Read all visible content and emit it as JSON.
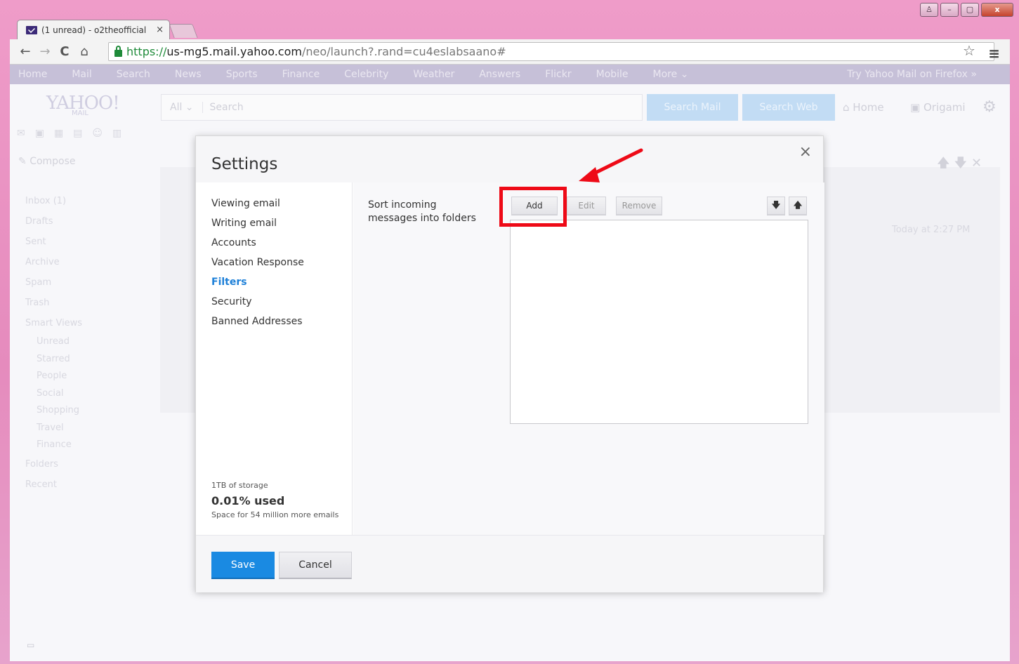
{
  "browser": {
    "tab_title": "(1 unread) - o2theofficial",
    "tab_close": "×",
    "url_scheme": "https://",
    "url_host": "us-mg5.mail.yahoo.com",
    "url_path": "/neo/launch?.rand=cu4eslabsaano#",
    "nav": {
      "back": "←",
      "forward": "→",
      "reload": "C",
      "home": "⌂"
    },
    "star": "☆",
    "menu": "≡",
    "window_controls": {
      "user": "♙",
      "min": "–",
      "max": "▢",
      "close": "x"
    }
  },
  "yahoo_nav": [
    "Home",
    "Mail",
    "Search",
    "News",
    "Sports",
    "Finance",
    "Celebrity",
    "Weather",
    "Answers",
    "Flickr",
    "Mobile",
    "More ⌄"
  ],
  "yahoo_nav_right": "Try Yahoo Mail on Firefox »",
  "header": {
    "logo": "YAHOO!",
    "logo_sub": "MAIL",
    "search_scope": "All ⌄",
    "search_placeholder": "Search",
    "search_mail": "Search Mail",
    "search_web": "Search Web",
    "home": "Home",
    "user": "Origami"
  },
  "sidebar": {
    "compose": "Compose",
    "folders": [
      "Inbox (1)",
      "Drafts",
      "Sent",
      "Archive",
      "Spam",
      "Trash",
      "Smart Views"
    ],
    "smart_views": [
      "Unread",
      "Starred",
      "People",
      "Social",
      "Shopping",
      "Travel",
      "Finance"
    ],
    "groups": [
      "Folders",
      "Recent"
    ]
  },
  "message_list": {
    "date": "Today at 2:27 PM"
  },
  "settings": {
    "title": "Settings",
    "close": "×",
    "menu": [
      {
        "label": "Viewing email",
        "active": false
      },
      {
        "label": "Writing email",
        "active": false
      },
      {
        "label": "Accounts",
        "active": false
      },
      {
        "label": "Vacation Response",
        "active": false
      },
      {
        "label": "Filters",
        "active": true
      },
      {
        "label": "Security",
        "active": false
      },
      {
        "label": "Banned Addresses",
        "active": false
      }
    ],
    "storage": {
      "capacity": "1TB of storage",
      "used": "0.01% used",
      "space": "Space for 54 million more emails"
    },
    "filters": {
      "label": "Sort incoming messages into folders",
      "add": "Add",
      "edit": "Edit",
      "remove": "Remove",
      "down": "🡇",
      "up": "🡅"
    },
    "save": "Save",
    "cancel": "Cancel"
  },
  "colors": {
    "accent": "#1a8ae2",
    "active_menu": "#1e80d8",
    "highlight": "#ee0a17",
    "window_frame": "#e58bbd"
  }
}
